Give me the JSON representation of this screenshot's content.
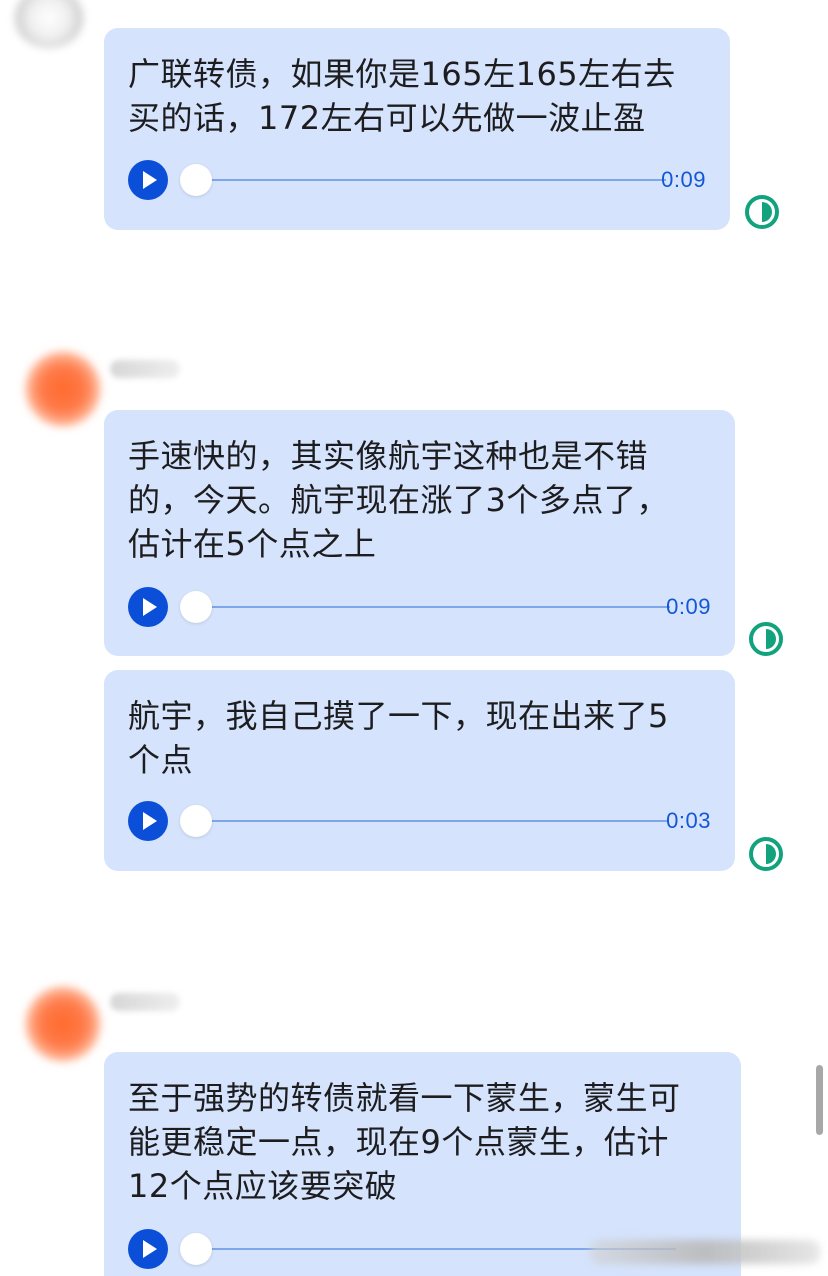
{
  "messages": [
    {
      "text": "广联转债，如果你是165左165左右去\n买的话，172左右可以先做一波止盈",
      "duration": "0:09"
    },
    {
      "text": "手速快的，其实像航宇这种也是不错\n的，今天。航宇现在涨了3个多点了，\n估计在5个点之上",
      "duration": "0:09"
    },
    {
      "text": "航宇，我自己摸了一下，现在出来了5\n个点",
      "duration": "0:03"
    },
    {
      "text": "至于强势的转债就看一下蒙生，蒙生可\n能更稳定一点，现在9个点蒙生，估计\n12个点应该要突破",
      "duration": ""
    }
  ],
  "icons": {
    "play": "play-icon",
    "status": "clock-status-icon"
  },
  "colors": {
    "bubble": "#d5e3fc",
    "play_button": "#0b4fd9",
    "duration_text": "#1357d6",
    "status_icon": "#12a27e"
  }
}
